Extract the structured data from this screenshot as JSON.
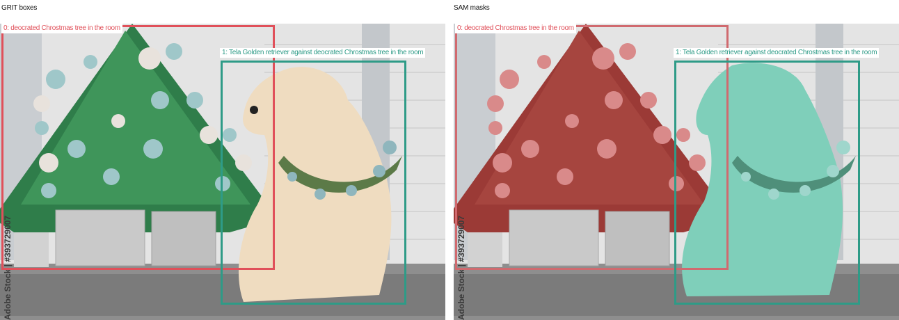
{
  "panels": {
    "left_title": "GRIT boxes",
    "right_title": "SAM masks"
  },
  "detections": [
    {
      "label": "0: deocrated Chrostmas tree in the room",
      "color": "#e0505a"
    },
    {
      "label": "1: Tela Golden retriever against deocrated Chrostmas tree in the room",
      "color": "#2e9b87"
    }
  ],
  "watermark": "Adobe Stock | #393729007",
  "colors": {
    "mask_tree": "#c8282f",
    "mask_dog": "#3cc8ac"
  }
}
